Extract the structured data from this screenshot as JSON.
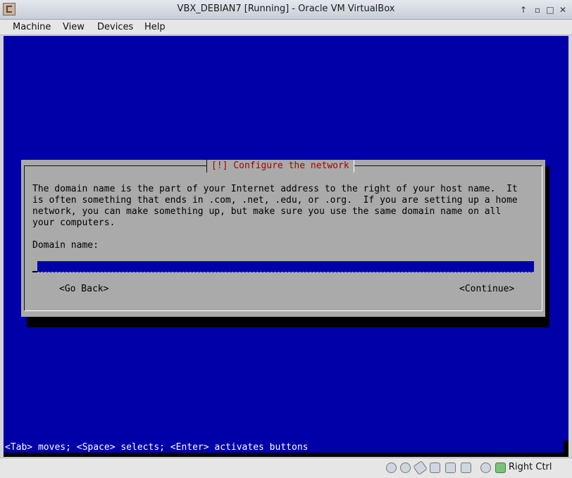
{
  "window": {
    "title": "VBX_DEBIAN7 [Running] - Oracle VM VirtualBox",
    "controls": [
      "arrow-up-icon",
      "minimize-icon",
      "maximize-icon",
      "close-icon"
    ]
  },
  "menu": {
    "machine": "Machine",
    "view": "View",
    "devices": "Devices",
    "help": "Help"
  },
  "installer": {
    "dialog_title": "[!] Configure the network",
    "description": "The domain name is the part of your Internet address to the right of your host name.  It\nis often something that ends in .com, .net, .edu, or .org.  If you are setting up a home\nnetwork, you can make something up, but make sure you use the same domain name on all\nyour computers.",
    "field_label": "Domain name:",
    "domain_value": "",
    "go_back": "<Go Back>",
    "continue": "<Continue>",
    "help_line": "<Tab> moves; <Space> selects; <Enter> activates buttons"
  },
  "statusbar": {
    "icons": [
      "hard-disk-icon",
      "optical-drive-icon",
      "usb-icon",
      "shared-folders-icon",
      "display-icon",
      "video-capture-icon",
      "network-icon",
      "mouse-integration-icon"
    ],
    "host_key": "Right Ctrl"
  },
  "colors": {
    "guest_background": "#0000a8",
    "dialog_background": "#aaaaaa",
    "dialog_title": "#a80000"
  }
}
